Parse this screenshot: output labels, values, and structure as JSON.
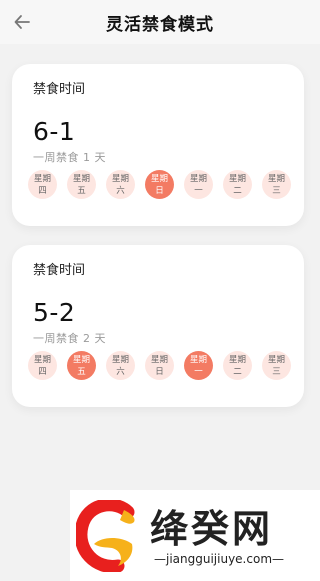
{
  "header": {
    "title": "灵活禁食模式"
  },
  "cards": [
    {
      "title": "禁食时间",
      "code": "6-1",
      "description": "一周禁食 1 天",
      "days": [
        {
          "line1": "星期",
          "line2": "四",
          "active": false
        },
        {
          "line1": "星期",
          "line2": "五",
          "active": false
        },
        {
          "line1": "星期",
          "line2": "六",
          "active": false
        },
        {
          "line1": "星期",
          "line2": "日",
          "active": true
        },
        {
          "line1": "星期",
          "line2": "一",
          "active": false
        },
        {
          "line1": "星期",
          "line2": "二",
          "active": false
        },
        {
          "line1": "星期",
          "line2": "三",
          "active": false
        }
      ]
    },
    {
      "title": "禁食时间",
      "code": "5-2",
      "description": "一周禁食 2 天",
      "days": [
        {
          "line1": "星期",
          "line2": "四",
          "active": false
        },
        {
          "line1": "星期",
          "line2": "五",
          "active": true
        },
        {
          "line1": "星期",
          "line2": "六",
          "active": false
        },
        {
          "line1": "星期",
          "line2": "日",
          "active": false
        },
        {
          "line1": "星期",
          "line2": "一",
          "active": true
        },
        {
          "line1": "星期",
          "line2": "二",
          "active": false
        },
        {
          "line1": "星期",
          "line2": "三",
          "active": false
        }
      ]
    }
  ],
  "watermark": {
    "name": "绛癸网",
    "url": "—jiangguijiuye.com—"
  },
  "colors": {
    "accent": "#f37b63",
    "day_inactive": "#fde6e1",
    "background": "#f2f2f2"
  }
}
